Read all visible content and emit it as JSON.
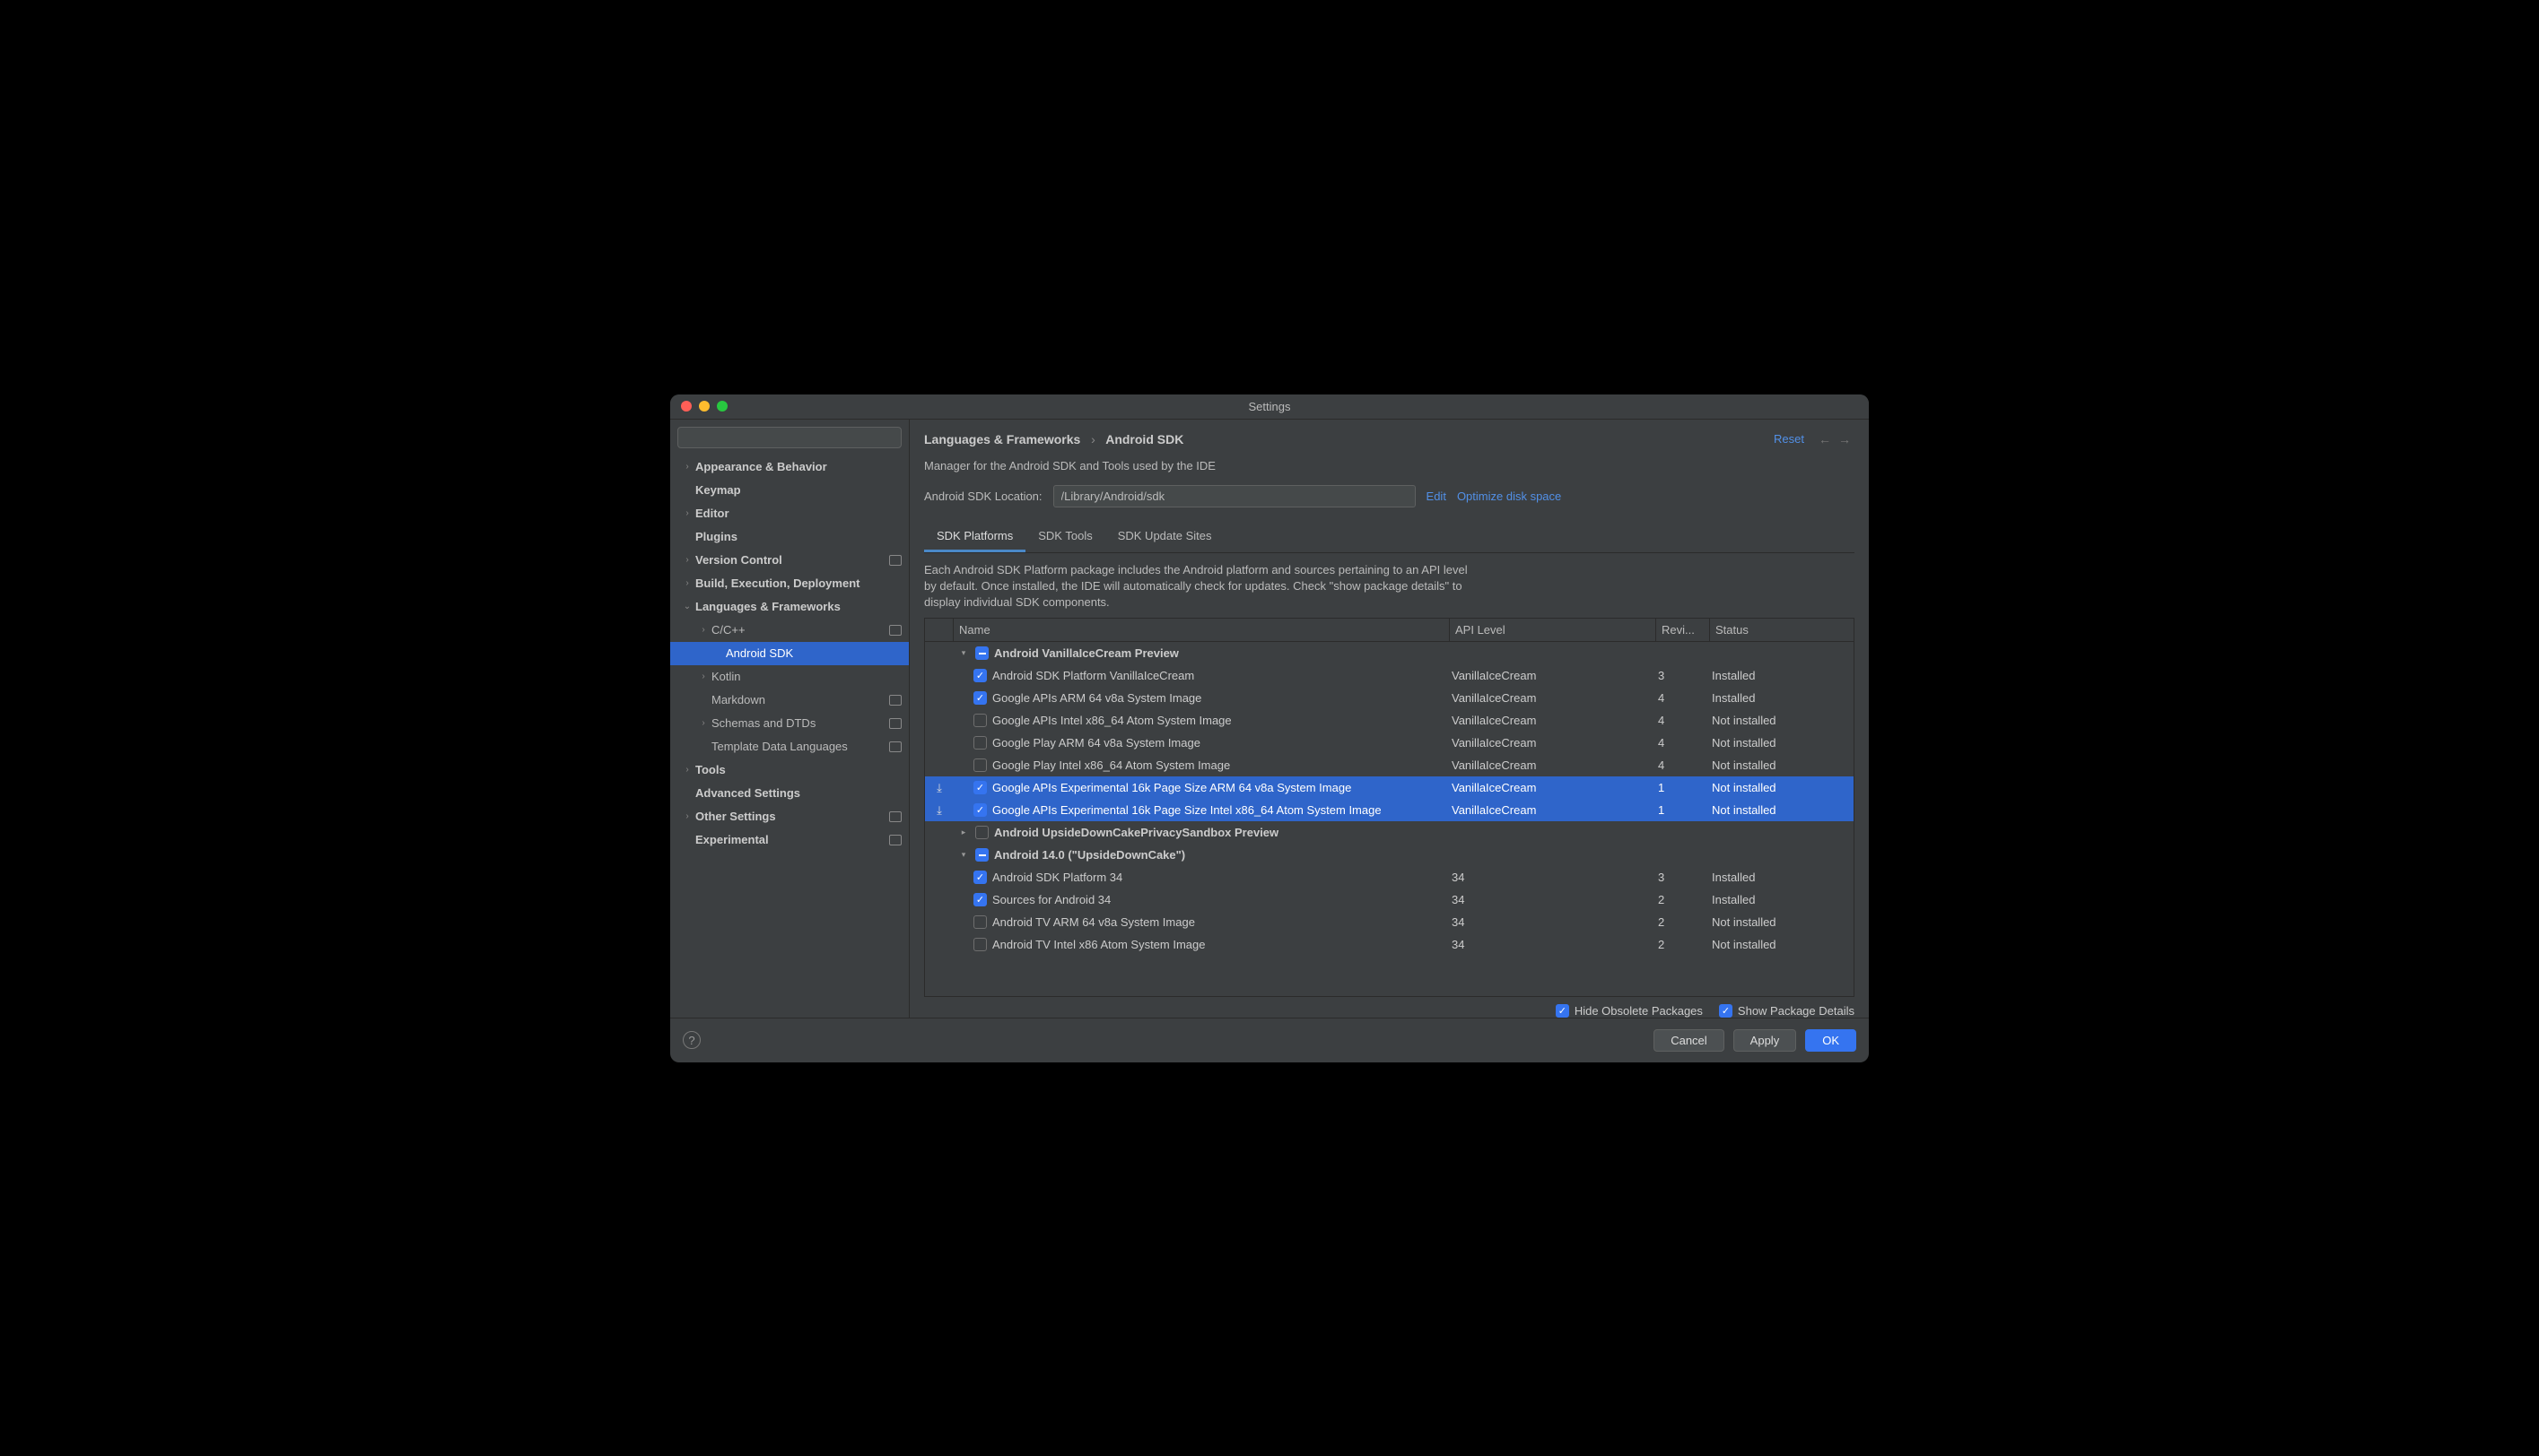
{
  "window": {
    "title": "Settings"
  },
  "search": {
    "placeholder": ""
  },
  "sidebar": {
    "items": [
      {
        "label": "Appearance & Behavior",
        "indent": 0,
        "arrow": "›",
        "bold": true
      },
      {
        "label": "Keymap",
        "indent": 0,
        "bold": true
      },
      {
        "label": "Editor",
        "indent": 0,
        "arrow": "›",
        "bold": true
      },
      {
        "label": "Plugins",
        "indent": 0,
        "bold": true
      },
      {
        "label": "Version Control",
        "indent": 0,
        "arrow": "›",
        "bold": true,
        "badge": true
      },
      {
        "label": "Build, Execution, Deployment",
        "indent": 0,
        "arrow": "›",
        "bold": true
      },
      {
        "label": "Languages & Frameworks",
        "indent": 0,
        "arrow": "⌄",
        "bold": true
      },
      {
        "label": "C/C++",
        "indent": 1,
        "arrow": "›",
        "badge": true
      },
      {
        "label": "Android SDK",
        "indent": 2,
        "selected": true
      },
      {
        "label": "Kotlin",
        "indent": 1,
        "arrow": "›"
      },
      {
        "label": "Markdown",
        "indent": 1,
        "badge": true
      },
      {
        "label": "Schemas and DTDs",
        "indent": 1,
        "arrow": "›",
        "badge": true
      },
      {
        "label": "Template Data Languages",
        "indent": 1,
        "badge": true
      },
      {
        "label": "Tools",
        "indent": 0,
        "arrow": "›",
        "bold": true
      },
      {
        "label": "Advanced Settings",
        "indent": 0,
        "bold": true
      },
      {
        "label": "Other Settings",
        "indent": 0,
        "arrow": "›",
        "bold": true,
        "badge": true
      },
      {
        "label": "Experimental",
        "indent": 0,
        "bold": true,
        "badge": true
      }
    ]
  },
  "breadcrumb": {
    "part1": "Languages & Frameworks",
    "part2": "Android SDK"
  },
  "reset": "Reset",
  "manager_desc": "Manager for the Android SDK and Tools used by the IDE",
  "location": {
    "label": "Android SDK Location:",
    "value": "/Library/Android/sdk",
    "edit": "Edit",
    "optimize": "Optimize disk space"
  },
  "tabs": [
    {
      "label": "SDK Platforms",
      "active": true
    },
    {
      "label": "SDK Tools"
    },
    {
      "label": "SDK Update Sites"
    }
  ],
  "info": "Each Android SDK Platform package includes the Android platform and sources pertaining to an API level by default. Once installed, the IDE will automatically check for updates. Check \"show package details\" to display individual SDK components.",
  "columns": {
    "name": "Name",
    "api": "API Level",
    "rev": "Revi...",
    "status": "Status"
  },
  "rows": [
    {
      "type": "group",
      "expanded": true,
      "check": "mixed",
      "name": "Android VanillaIceCream Preview"
    },
    {
      "type": "item",
      "check": "checked",
      "name": "Android SDK Platform VanillaIceCream",
      "api": "VanillaIceCream",
      "rev": "3",
      "status": "Installed"
    },
    {
      "type": "item",
      "check": "checked",
      "name": "Google APIs ARM 64 v8a System Image",
      "api": "VanillaIceCream",
      "rev": "4",
      "status": "Installed"
    },
    {
      "type": "item",
      "check": "",
      "name": "Google APIs Intel x86_64 Atom System Image",
      "api": "VanillaIceCream",
      "rev": "4",
      "status": "Not installed"
    },
    {
      "type": "item",
      "check": "",
      "name": "Google Play ARM 64 v8a System Image",
      "api": "VanillaIceCream",
      "rev": "4",
      "status": "Not installed"
    },
    {
      "type": "item",
      "check": "",
      "name": "Google Play Intel x86_64 Atom System Image",
      "api": "VanillaIceCream",
      "rev": "4",
      "status": "Not installed"
    },
    {
      "type": "item",
      "check": "checked",
      "name": "Google APIs Experimental 16k Page Size ARM 64 v8a System Image",
      "api": "VanillaIceCream",
      "rev": "1",
      "status": "Not installed",
      "selected": true,
      "dl": true
    },
    {
      "type": "item",
      "check": "checked",
      "name": "Google APIs Experimental 16k Page Size Intel x86_64 Atom System Image",
      "api": "VanillaIceCream",
      "rev": "1",
      "status": "Not installed",
      "selected": true,
      "dl": true
    },
    {
      "type": "group",
      "expanded": false,
      "check": "",
      "name": "Android UpsideDownCakePrivacySandbox Preview"
    },
    {
      "type": "group",
      "expanded": true,
      "check": "mixed",
      "name": "Android 14.0 (\"UpsideDownCake\")"
    },
    {
      "type": "item",
      "check": "checked",
      "name": "Android SDK Platform 34",
      "api": "34",
      "rev": "3",
      "status": "Installed"
    },
    {
      "type": "item",
      "check": "checked",
      "name": "Sources for Android 34",
      "api": "34",
      "rev": "2",
      "status": "Installed"
    },
    {
      "type": "item",
      "check": "",
      "name": "Android TV ARM 64 v8a System Image",
      "api": "34",
      "rev": "2",
      "status": "Not installed"
    },
    {
      "type": "item",
      "check": "",
      "name": "Android TV Intel x86 Atom System Image",
      "api": "34",
      "rev": "2",
      "status": "Not installed"
    }
  ],
  "options": {
    "hide": "Hide Obsolete Packages",
    "details": "Show Package Details"
  },
  "buttons": {
    "cancel": "Cancel",
    "apply": "Apply",
    "ok": "OK"
  }
}
